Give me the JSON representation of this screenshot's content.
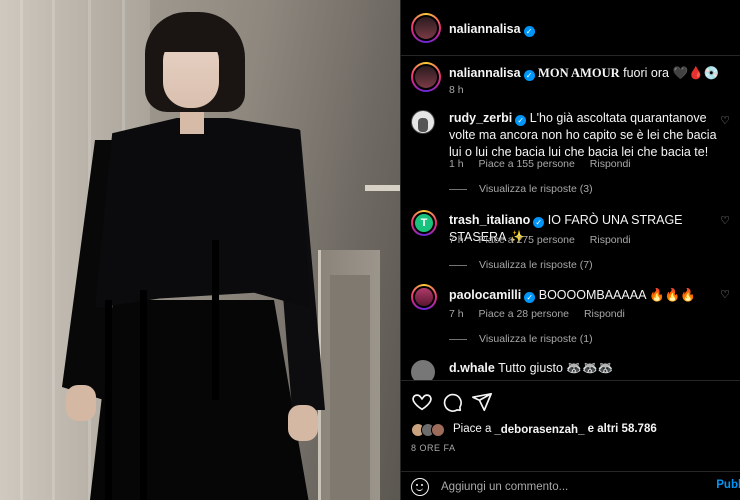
{
  "header": {
    "username": "naliannalisa",
    "verified": true
  },
  "caption": {
    "username": "naliannalisa",
    "title_text": "MON AMOUR",
    "rest_text": " fuori ora 🖤🩸💿",
    "time": "8 h"
  },
  "comments": [
    {
      "username": "rudy_zerbi",
      "verified": true,
      "text": "L'ho già ascoltata quarantanove volte ma ancora non ho capito se è lei che bacia lui o lui che bacia lui che bacia lei che bacia te!",
      "time": "1 h",
      "likes": "Piace a 155 persone",
      "reply": "Rispondi",
      "view_replies": "Visualizza le risposte (3)",
      "avatar_color": "#e6e6e6"
    },
    {
      "username": "trash_italiano",
      "verified": true,
      "text": "IO FARÒ UNA STRAGE STASERA ✨",
      "time": "7 h",
      "likes": "Piace a 275 persone",
      "reply": "Rispondi",
      "view_replies": "Visualizza le risposte (7)",
      "avatar_color": "#19c37d"
    },
    {
      "username": "paolocamilli",
      "verified": true,
      "text": "BOOOOMBAAAAA 🔥🔥🔥",
      "time": "7 h",
      "likes": "Piace a 28 persone",
      "reply": "Rispondi",
      "view_replies": "Visualizza le risposte (1)",
      "avatar_color": "#8a1f4a"
    },
    {
      "username": "d.whale",
      "verified": false,
      "text": "Tutto giusto 🦝🦝🦝",
      "avatar_color": "#777777"
    }
  ],
  "actions": {
    "like_icon": "heart-icon",
    "comment_icon": "comment-icon",
    "share_icon": "share-icon",
    "liked_prefix": "Piace a ",
    "liked_user": "_deborasenzah_",
    "liked_suffix": " e altri 58.786",
    "date": "8 ORE FA"
  },
  "comment_input": {
    "placeholder": "Aggiungi un commento...",
    "publish": "Pubb"
  },
  "colors": {
    "accent": "#0095f6",
    "background": "#000000",
    "muted": "#a8a8a8"
  }
}
